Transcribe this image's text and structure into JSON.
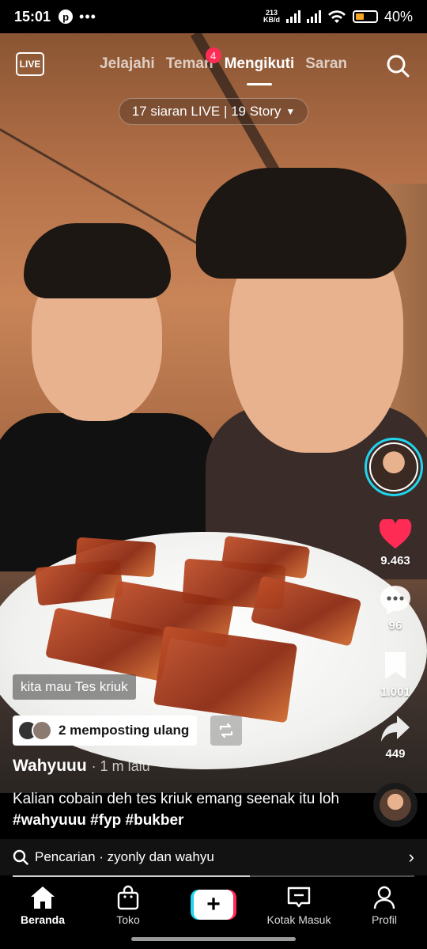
{
  "status_bar": {
    "time": "15:01",
    "speed_top": "213",
    "speed_bottom": "KB/d",
    "battery": "40%",
    "battery_level": 0.4
  },
  "top_nav": {
    "live_label": "LIVE",
    "tabs": [
      {
        "label": "Jelajahi",
        "active": false
      },
      {
        "label": "Teman",
        "active": false,
        "badge": "4"
      },
      {
        "label": "Mengikuti",
        "active": true
      },
      {
        "label": "Saran",
        "active": false
      }
    ]
  },
  "live_pill": "17 siaran LIVE | 19 Story",
  "video": {
    "tag_label": "kita mau Tes kriuk",
    "repost_text": "2 memposting ulang",
    "author": "Wahyuuu",
    "post_time": "· 1 m lalu",
    "caption": "Kalian cobain deh tes kriuk emang seenak itu loh ",
    "hashtags": "#wahyuuu #fyp #bukber"
  },
  "actions": {
    "likes": "9.463",
    "comments": "96",
    "saves": "1.001",
    "shares": "449"
  },
  "search_bar": {
    "label": "Pencarian · zyonly dan wahyu"
  },
  "playback_progress": 0.59,
  "bottom_nav": {
    "items": [
      {
        "label": "Beranda",
        "icon": "home-icon",
        "active": true
      },
      {
        "label": "Toko",
        "icon": "shop-bag-icon",
        "active": false
      },
      {
        "label": "",
        "icon": "create-plus-icon",
        "active": false
      },
      {
        "label": "Kotak Masuk",
        "icon": "inbox-icon",
        "active": false
      },
      {
        "label": "Profil",
        "icon": "profile-icon",
        "active": false
      }
    ]
  },
  "colors": {
    "accent_red": "#fe2c55",
    "accent_cyan": "#20d5ec",
    "battery_orange": "#f5a623"
  }
}
